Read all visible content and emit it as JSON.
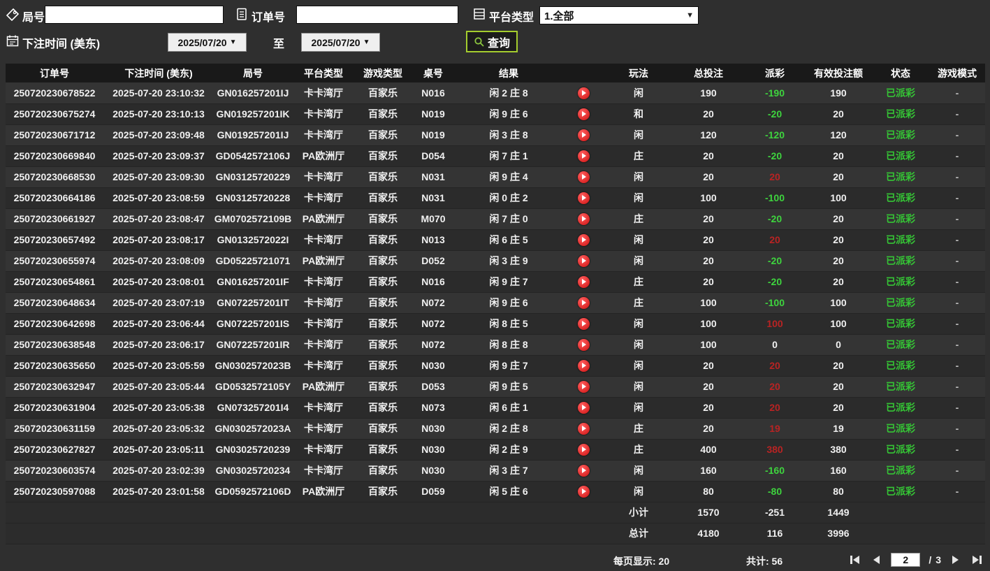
{
  "filters": {
    "round_label": "局号",
    "round_value": "",
    "order_label": "订单号",
    "order_value": "",
    "platform_label": "平台类型",
    "platform_value": "1.全部",
    "bet_time_label": "下注时间 (美东)",
    "date_from": "2025/07/20",
    "to_label": "至",
    "date_to": "2025/07/20",
    "query_label": "查询"
  },
  "table": {
    "headers": [
      "订单号",
      "下注时间 (美东)",
      "局号",
      "平台类型",
      "游戏类型",
      "桌号",
      "结果",
      "",
      "玩法",
      "总投注",
      "派彩",
      "有效投注额",
      "状态",
      "游戏模式"
    ],
    "rows": [
      [
        "250720230678522",
        "2025-07-20 23:10:32",
        "GN016257201IJ",
        "卡卡湾厅",
        "百家乐",
        "N016",
        "闲 2 庄 8",
        "闲",
        "190",
        "-190",
        "neg",
        "190",
        "已派彩",
        "-"
      ],
      [
        "250720230675274",
        "2025-07-20 23:10:13",
        "GN019257201IK",
        "卡卡湾厅",
        "百家乐",
        "N019",
        "闲 9 庄 6",
        "和",
        "20",
        "-20",
        "neg",
        "20",
        "已派彩",
        "-"
      ],
      [
        "250720230671712",
        "2025-07-20 23:09:48",
        "GN019257201IJ",
        "卡卡湾厅",
        "百家乐",
        "N019",
        "闲 3 庄 8",
        "闲",
        "120",
        "-120",
        "neg",
        "120",
        "已派彩",
        "-"
      ],
      [
        "250720230669840",
        "2025-07-20 23:09:37",
        "GD0542572106J",
        "PA欧洲厅",
        "百家乐",
        "D054",
        "闲 7 庄 1",
        "庄",
        "20",
        "-20",
        "neg",
        "20",
        "已派彩",
        "-"
      ],
      [
        "250720230668530",
        "2025-07-20 23:09:30",
        "GN03125720229",
        "卡卡湾厅",
        "百家乐",
        "N031",
        "闲 9 庄 4",
        "闲",
        "20",
        "20",
        "pos",
        "20",
        "已派彩",
        "-"
      ],
      [
        "250720230664186",
        "2025-07-20 23:08:59",
        "GN03125720228",
        "卡卡湾厅",
        "百家乐",
        "N031",
        "闲 0 庄 2",
        "闲",
        "100",
        "-100",
        "neg",
        "100",
        "已派彩",
        "-"
      ],
      [
        "250720230661927",
        "2025-07-20 23:08:47",
        "GM0702572109B",
        "PA欧洲厅",
        "百家乐",
        "M070",
        "闲 7 庄 0",
        "庄",
        "20",
        "-20",
        "neg",
        "20",
        "已派彩",
        "-"
      ],
      [
        "250720230657492",
        "2025-07-20 23:08:17",
        "GN0132572022I",
        "卡卡湾厅",
        "百家乐",
        "N013",
        "闲 6 庄 5",
        "闲",
        "20",
        "20",
        "pos",
        "20",
        "已派彩",
        "-"
      ],
      [
        "250720230655974",
        "2025-07-20 23:08:09",
        "GD05225721071",
        "PA欧洲厅",
        "百家乐",
        "D052",
        "闲 3 庄 9",
        "闲",
        "20",
        "-20",
        "neg",
        "20",
        "已派彩",
        "-"
      ],
      [
        "250720230654861",
        "2025-07-20 23:08:01",
        "GN016257201IF",
        "卡卡湾厅",
        "百家乐",
        "N016",
        "闲 9 庄 7",
        "庄",
        "20",
        "-20",
        "neg",
        "20",
        "已派彩",
        "-"
      ],
      [
        "250720230648634",
        "2025-07-20 23:07:19",
        "GN072257201IT",
        "卡卡湾厅",
        "百家乐",
        "N072",
        "闲 9 庄 6",
        "庄",
        "100",
        "-100",
        "neg",
        "100",
        "已派彩",
        "-"
      ],
      [
        "250720230642698",
        "2025-07-20 23:06:44",
        "GN072257201IS",
        "卡卡湾厅",
        "百家乐",
        "N072",
        "闲 8 庄 5",
        "闲",
        "100",
        "100",
        "pos",
        "100",
        "已派彩",
        "-"
      ],
      [
        "250720230638548",
        "2025-07-20 23:06:17",
        "GN072257201IR",
        "卡卡湾厅",
        "百家乐",
        "N072",
        "闲 8 庄 8",
        "闲",
        "100",
        "0",
        "zero",
        "0",
        "已派彩",
        "-"
      ],
      [
        "250720230635650",
        "2025-07-20 23:05:59",
        "GN0302572023B",
        "卡卡湾厅",
        "百家乐",
        "N030",
        "闲 9 庄 7",
        "闲",
        "20",
        "20",
        "pos",
        "20",
        "已派彩",
        "-"
      ],
      [
        "250720230632947",
        "2025-07-20 23:05:44",
        "GD0532572105Y",
        "PA欧洲厅",
        "百家乐",
        "D053",
        "闲 9 庄 5",
        "闲",
        "20",
        "20",
        "pos",
        "20",
        "已派彩",
        "-"
      ],
      [
        "250720230631904",
        "2025-07-20 23:05:38",
        "GN073257201I4",
        "卡卡湾厅",
        "百家乐",
        "N073",
        "闲 6 庄 1",
        "闲",
        "20",
        "20",
        "pos",
        "20",
        "已派彩",
        "-"
      ],
      [
        "250720230631159",
        "2025-07-20 23:05:32",
        "GN0302572023A",
        "卡卡湾厅",
        "百家乐",
        "N030",
        "闲 2 庄 8",
        "庄",
        "20",
        "19",
        "pos",
        "19",
        "已派彩",
        "-"
      ],
      [
        "250720230627827",
        "2025-07-20 23:05:11",
        "GN03025720239",
        "卡卡湾厅",
        "百家乐",
        "N030",
        "闲 2 庄 9",
        "庄",
        "400",
        "380",
        "pos",
        "380",
        "已派彩",
        "-"
      ],
      [
        "250720230603574",
        "2025-07-20 23:02:39",
        "GN03025720234",
        "卡卡湾厅",
        "百家乐",
        "N030",
        "闲 3 庄 7",
        "闲",
        "160",
        "-160",
        "neg",
        "160",
        "已派彩",
        "-"
      ],
      [
        "250720230597088",
        "2025-07-20 23:01:58",
        "GD0592572106D",
        "PA欧洲厅",
        "百家乐",
        "D059",
        "闲 5 庄 6",
        "闲",
        "80",
        "-80",
        "neg",
        "80",
        "已派彩",
        "-"
      ]
    ]
  },
  "summary": {
    "subtotal_label": "小计",
    "subtotal": {
      "total_bet": "1570",
      "payout": "-251",
      "valid_bet": "1449"
    },
    "total_label": "总计",
    "total": {
      "total_bet": "4180",
      "payout": "116",
      "valid_bet": "3996"
    }
  },
  "footer": {
    "per_page": "每页显示: 20",
    "total_count": "共计: 56",
    "current_page": "2",
    "page_separator": "/",
    "total_pages": "3"
  },
  "colors": {
    "payout_negative": "#3ed43e",
    "payout_positive": "#b92323",
    "status_paid": "#35c435",
    "summary_yellow": "#ffe100",
    "query_border": "#a4cd2e",
    "play_button": "#cf1010",
    "background": "#2f2f2f",
    "header_row": "#191919"
  }
}
